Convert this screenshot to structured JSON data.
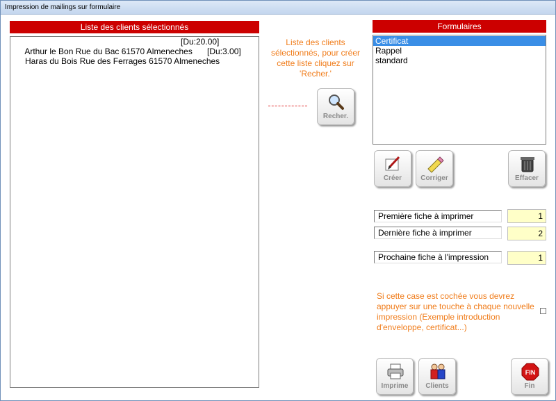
{
  "window": {
    "title": "Impression de mailings sur formulaire"
  },
  "clients": {
    "header": "Liste des clients sélectionnés",
    "rows": [
      {
        "text": "Arthur le Bon Rue du Bac 61570 Almeneches",
        "amount": "[Du:20.00]"
      },
      {
        "text": "Haras du Bois Rue des Ferrages 61570 Almeneches",
        "amount": "[Du:3.00]"
      }
    ]
  },
  "hint": {
    "line1": "Liste des clients",
    "line2": "sélectionnés, pour créer",
    "line3": "cette liste cliquez sur",
    "line4": "'Recher.'"
  },
  "buttons": {
    "search": "Recher.",
    "create": "Créer",
    "edit": "Corriger",
    "delete": "Effacer",
    "print": "Imprime",
    "clients": "Clients",
    "end": "Fin"
  },
  "icons": {
    "search": "magnifier-icon",
    "create": "pen-paper-icon",
    "edit": "pencil-eraser-icon",
    "delete": "trash-can-icon",
    "print": "printer-icon",
    "clients": "people-icon",
    "end": "stop-sign-icon"
  },
  "formulaires": {
    "header": "Formulaires",
    "items": [
      "Certificat",
      "Rappel",
      "standard"
    ],
    "selected": "Certificat"
  },
  "fields": {
    "first_label": "Première fiche à imprimer",
    "first_value": "1",
    "last_label": "Dernière fiche à imprimer",
    "last_value": "2",
    "next_label": "Prochaine fiche à l'impression",
    "next_value": "1"
  },
  "note": {
    "line1": "Si cette case est cochée vous devrez",
    "line2": "appuyer sur une touche à chaque nouvelle",
    "line3": "impression (Exemple introduction",
    "line4": "d'enveloppe, certificat...)",
    "checked": false
  },
  "colors": {
    "header_red": "#cc0000",
    "hint_orange": "#f07c1a",
    "selection_blue": "#3a8ee6",
    "field_yellow": "#ffffc8"
  }
}
